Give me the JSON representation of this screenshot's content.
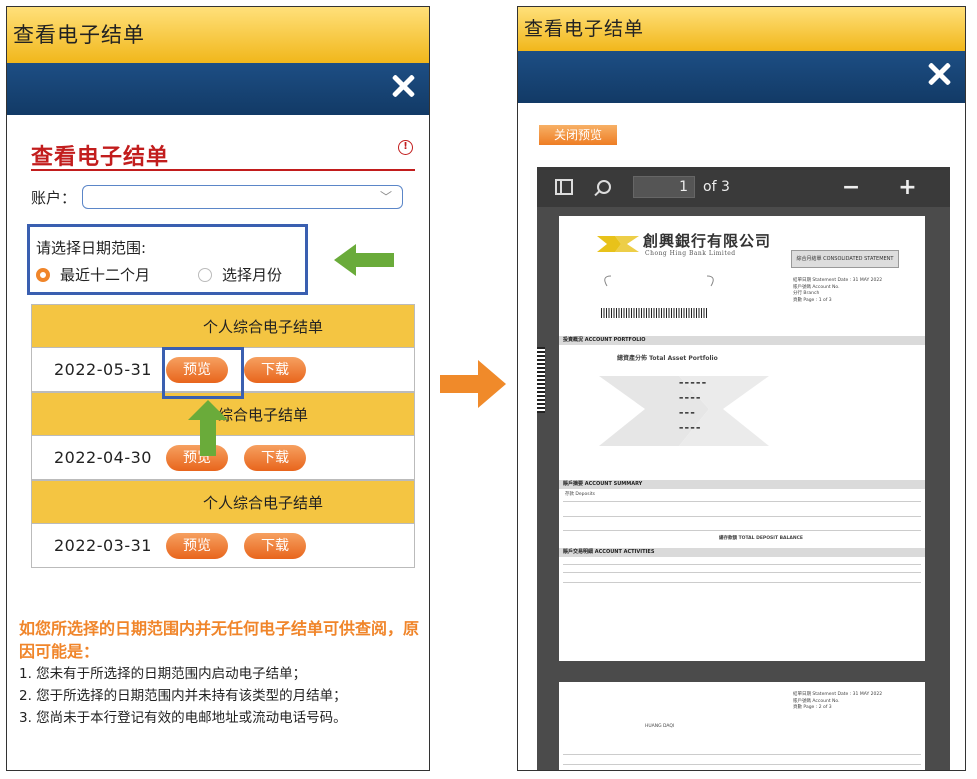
{
  "left_panel": {
    "title": "查看电子结单",
    "heading": "查看电子结单",
    "info_icon": "!",
    "account_label": "账户：",
    "date_range_prompt": "请选择日期范围:",
    "radio_last12": "最近十二个月",
    "radio_choose_month": "选择月份",
    "statements": [
      {
        "header": "个人综合电子结单",
        "date": "2022-05-31",
        "preview": "预览",
        "download": "下载"
      },
      {
        "header": "综合电子结单",
        "date": "2022-04-30",
        "preview": "预览",
        "download": "下载"
      },
      {
        "header": "个人综合电子结单",
        "date": "2022-03-31",
        "preview": "预览",
        "download": "下载"
      }
    ],
    "notice_title": "如您所选择的日期范围内并无任何电子结单可供查阅，原因可能是：",
    "notice_items": [
      "1. 您未有于所选择的日期范围内启动电子结单；",
      "2. 您于所选择的日期范围内并未持有该类型的月结单；",
      "3. 您尚未于本行登记有效的电邮地址或流动电话号码。"
    ]
  },
  "right_panel": {
    "title": "查看电子结单",
    "close_preview": "关闭预览",
    "viewer": {
      "page_current": "1",
      "page_total": "of 3",
      "zoom_out": "−",
      "zoom_in": "+"
    },
    "document": {
      "bank_name_cn": "創興銀行有限公司",
      "bank_name_en": "Chong Hing Bank Limited",
      "statement_title": "綜合月結單 CONSOLIDATED STATEMENT",
      "meta_lines": [
        "結單日期 Statement Date : 31 MAY 2022",
        "賬戶號碼 Account No.",
        "分行 Branch",
        "頁數 Page : 1 of 3"
      ],
      "section_portfolio": "投資概況 ACCOUNT PORTFOLIO",
      "total_asset": "總資產分佈 Total Asset Portfolio",
      "section_summary": "賬戶摘要 ACCOUNT SUMMARY",
      "deposits": "存款 Deposits",
      "total_deposit": "總存款額 TOTAL DEPOSIT BALANCE",
      "section_activities": "賬戶交易明細 ACCOUNT ACTIVITIES",
      "page2_name": "HUANG DAQI",
      "page2_meta": [
        "結單日期 Statement Date : 31 MAY 2022",
        "賬戶號碼 Account No.",
        "頁數 Page : 2 of 3"
      ]
    }
  },
  "colors": {
    "title_bar": "#f1b71b",
    "nav_bar": "#1d4e84",
    "accent_red": "#c21d1d",
    "button_orange": "#e8651c",
    "highlight_blue": "#3a5fb0",
    "arrow_green": "#6aab3a",
    "arrow_orange": "#f08a2a"
  }
}
